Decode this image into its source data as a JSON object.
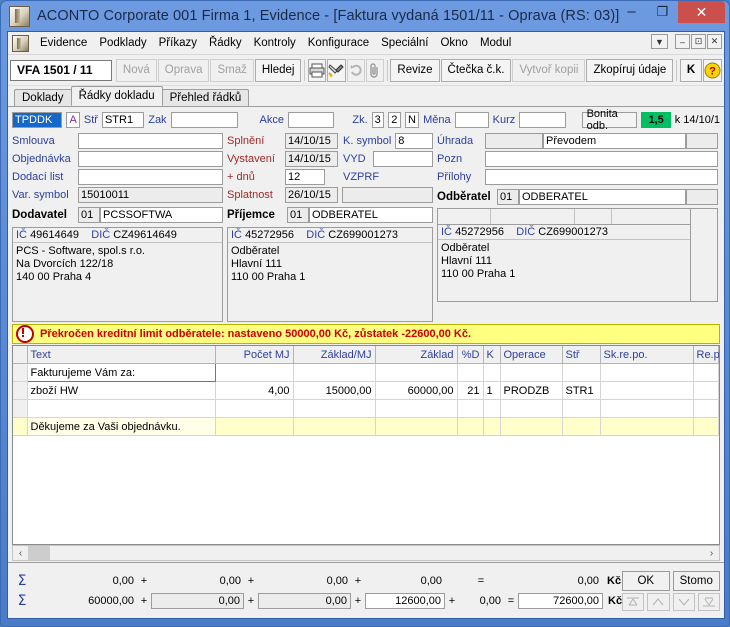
{
  "window": {
    "title": "ACONTO Corporate 001 Firma 1, Evidence - [Faktura vydaná 1501/11 - Oprava  (RS: 03)]",
    "minimize": "–",
    "maximize": "❐",
    "close": "✕"
  },
  "menu": {
    "items": [
      "Evidence",
      "Podklady",
      "Příkazy",
      "Řádky",
      "Kontroly",
      "Konfigurace",
      "Speciální",
      "Okno",
      "Modul"
    ],
    "mdi": {
      "dropdown": "▼",
      "minimize": "–",
      "restore": "⊡",
      "close": "✕"
    }
  },
  "toolbar": {
    "doc_number": "VFA 1501 / 11",
    "buttons": [
      {
        "label": "Nová",
        "enabled": false
      },
      {
        "label": "Oprava",
        "enabled": false
      },
      {
        "label": "Smaž",
        "enabled": false
      },
      {
        "label": "Hledej",
        "enabled": true
      },
      {
        "label": "Revize",
        "enabled": true
      },
      {
        "label": "Čtečka č.k.",
        "enabled": true
      },
      {
        "label": "Vytvoř kopii",
        "enabled": false
      },
      {
        "label": "Zkopíruj údaje",
        "enabled": true
      },
      {
        "label": "K",
        "enabled": true
      }
    ],
    "icons": [
      "print-icon",
      "brush-icon",
      "refresh-icon",
      "attachment-icon",
      "help-icon"
    ]
  },
  "tabs": [
    {
      "label": "Doklady",
      "active": false
    },
    {
      "label": "Řádky dokladu",
      "active": true
    },
    {
      "label": "Přehled řádků",
      "active": false
    }
  ],
  "header_row": {
    "doc_type_value": "TPDDK",
    "a_flag": "A",
    "str_label": "Stř",
    "str_value": "STR1",
    "zak_label": "Zak",
    "zak_value": "",
    "akce_label": "Akce",
    "akce_value": "",
    "zk_label": "Zk.",
    "zk_value1": "3",
    "zk_value2": "2",
    "n_flag": "N",
    "mena_label": "Měna",
    "mena_value": "",
    "kurz_label": "Kurz",
    "kurz_value": "",
    "bonita_label": "Bonita odb.",
    "bonita_value": "1,5",
    "bonita_date": "k 14/10/1"
  },
  "left_form": {
    "rows": [
      {
        "label": "Smlouva",
        "value": "",
        "readonly": false
      },
      {
        "label": "Objednávka",
        "value": "",
        "readonly": false
      },
      {
        "label": "Dodací list",
        "value": "",
        "readonly": false
      },
      {
        "label": "Var. symbol",
        "value": "15010011",
        "readonly": true
      }
    ],
    "party_label": "Dodavatel",
    "party_code": "01",
    "party_value": "PCSSOFTWA",
    "ic_label": "IČ",
    "ic_value": "49614649",
    "dic_label": "DIČ",
    "dic_value": "CZ49614649",
    "address": [
      "PCS - Software, spol.s r.o.",
      "Na Dvorcích 122/18",
      "140 00 Praha 4"
    ]
  },
  "mid_form": {
    "rows": [
      {
        "label": "Splnění",
        "value": "14/10/15"
      },
      {
        "label": "Vystavení",
        "value": "14/10/15"
      },
      {
        "label": "+ dnů",
        "value": "12"
      },
      {
        "label": "Splatnost",
        "value": "26/10/15"
      }
    ],
    "ksymbol_label": "K. symbol",
    "ksymbol_value": "8",
    "vyd_label": "VYD",
    "vyd_value": "",
    "vzprf_label": "VZPRF",
    "vzprf_value": "",
    "party_label": "Příjemce",
    "party_code": "01",
    "party_value": "ODBERATEL",
    "ic_label": "IČ",
    "ic_value": "45272956",
    "dic_label": "DIČ",
    "dic_value": "CZ699001273",
    "address": [
      "Odběratel",
      "Hlavní 111",
      "110 00 Praha 1"
    ]
  },
  "right_form": {
    "rows": [
      {
        "label": "Úhrada",
        "code": "",
        "value": "Převodem"
      },
      {
        "label": "Pozn",
        "code": "",
        "value": ""
      },
      {
        "label": "Přílohy",
        "code": "",
        "value": ""
      }
    ],
    "party_label": "Odběratel",
    "party_code": "01",
    "party_value": "ODBERATEL",
    "ic_label": "IČ",
    "ic_value": "45272956",
    "dic_label": "DIČ",
    "dic_value": "CZ699001273",
    "address": [
      "Odběratel",
      "Hlavní 111",
      "110 00 Praha 1"
    ]
  },
  "warning": {
    "icon": "error-icon",
    "text": "Překročen kreditní limit odběratele: nastaveno 50000,00 Kč, zůstatek -22600,00 Kč."
  },
  "grid": {
    "columns": [
      {
        "label": "Text",
        "align": "left"
      },
      {
        "label": "Počet MJ",
        "align": "right"
      },
      {
        "label": "Základ/MJ",
        "align": "right"
      },
      {
        "label": "Základ",
        "align": "right"
      },
      {
        "label": "%D",
        "align": "right"
      },
      {
        "label": "K",
        "align": "left"
      },
      {
        "label": "Operace",
        "align": "left"
      },
      {
        "label": "Stř",
        "align": "left"
      },
      {
        "label": "Sk.re.po.",
        "align": "left"
      },
      {
        "label": "Re.p",
        "align": "right"
      }
    ],
    "rows": [
      {
        "selected": true,
        "note": false,
        "cells": [
          "Fakturujeme Vám za:",
          "",
          "",
          "",
          "",
          "",
          "",
          "",
          "",
          ""
        ]
      },
      {
        "selected": false,
        "note": false,
        "cells": [
          "zboží HW",
          "4,00",
          "15000,00",
          "60000,00",
          "21",
          "1",
          "PRODZB",
          "STR1",
          "",
          ""
        ]
      },
      {
        "selected": false,
        "note": false,
        "cells": [
          "",
          "",
          "",
          "",
          "",
          "",
          "",
          "",
          "",
          ""
        ]
      },
      {
        "selected": false,
        "note": true,
        "cells": [
          "Děkujeme za Vaši objednávku.",
          "",
          "",
          "",
          "",
          "",
          "",
          "",
          "",
          ""
        ]
      }
    ]
  },
  "hscroll": {
    "left_arrow": "‹",
    "right_arrow": "›"
  },
  "footer": {
    "sigma": "Σ",
    "row1": {
      "a": "0,00",
      "op1": "+",
      "b": "0,00",
      "op2": "+",
      "c": "0,00",
      "op3": "+",
      "d": "0,00",
      "op4": "",
      "eq": "=",
      "total": "0,00",
      "currency": "Kč"
    },
    "row2": {
      "a": "60000,00",
      "op1": "+",
      "b": "0,00",
      "op2": "+",
      "c": "0,00",
      "op3": "+",
      "d": "12600,00",
      "op4": "+",
      "e": "0,00",
      "eq": "=",
      "total": "72600,00",
      "currency": "Kč"
    },
    "ok_label": "OK",
    "cancel_label": "Stomo",
    "nav": [
      "first-record-icon",
      "prev-record-icon",
      "next-record-icon",
      "last-record-icon"
    ]
  }
}
